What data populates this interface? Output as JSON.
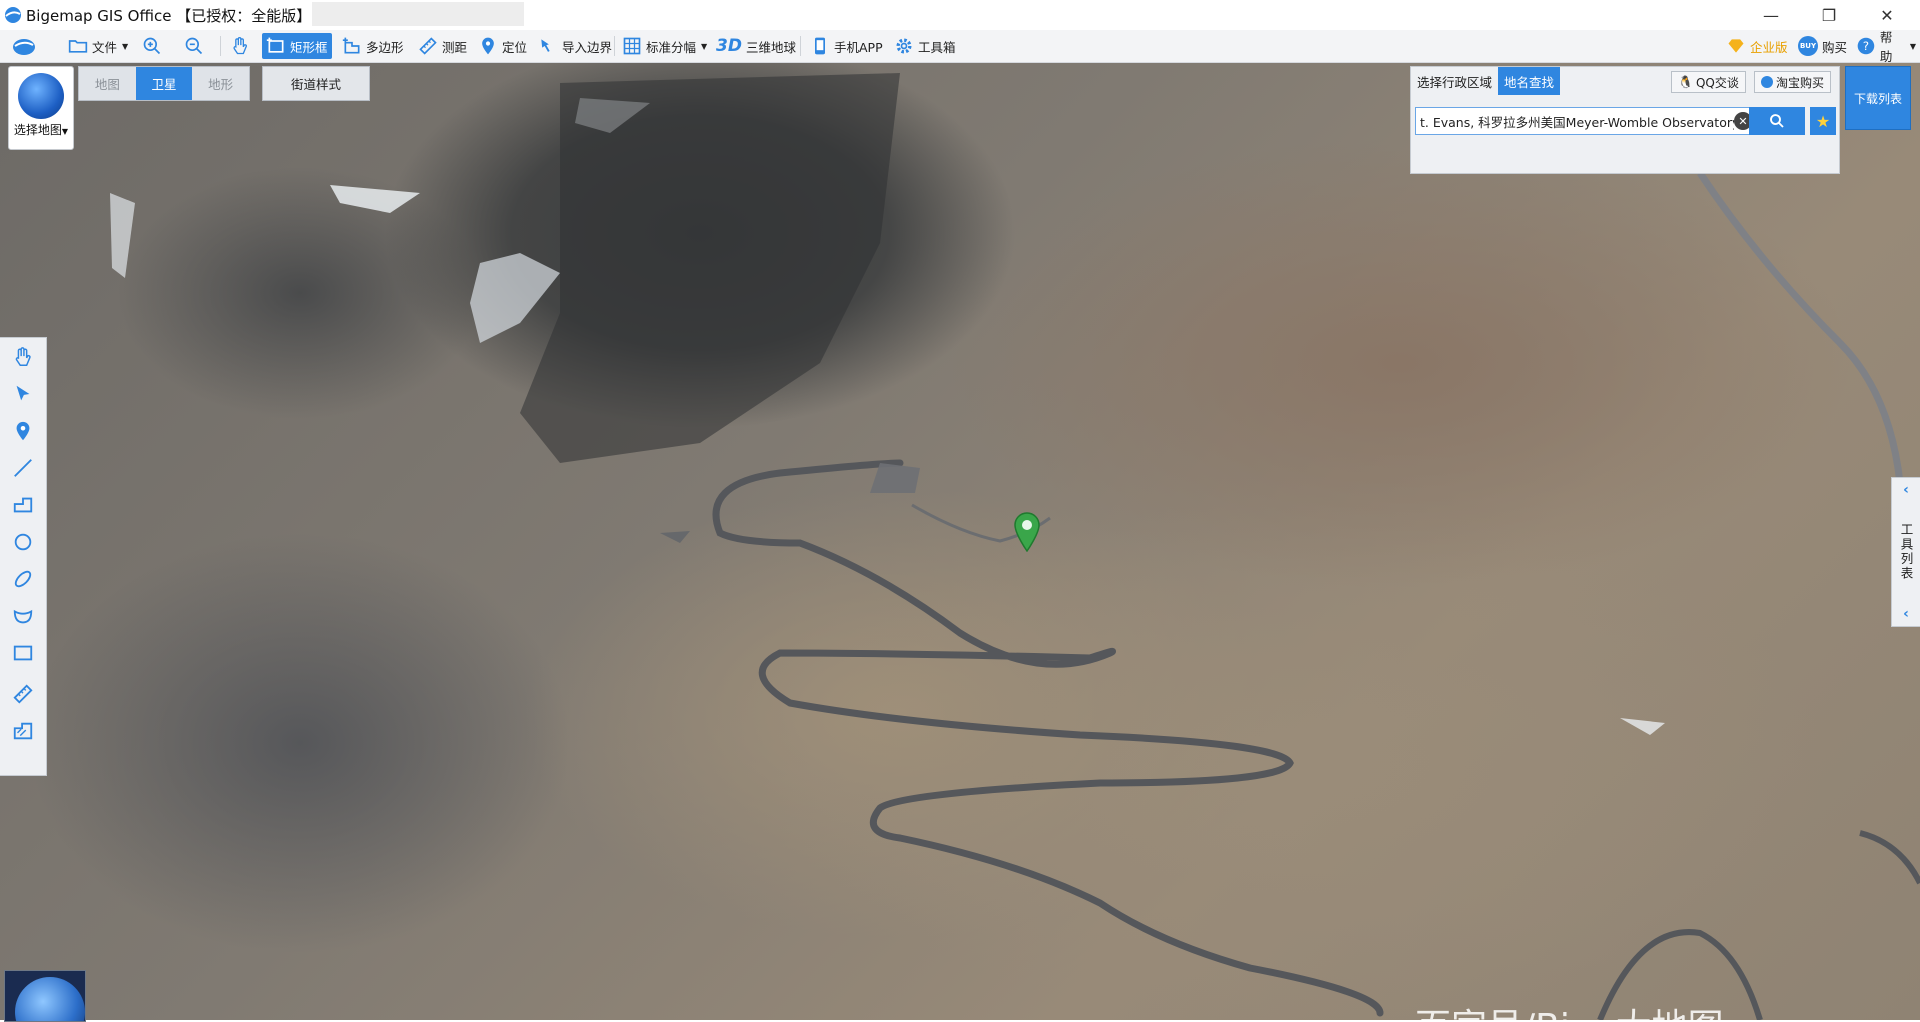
{
  "window": {
    "title": "Bigemap GIS Office 【已授权：全能版】",
    "controls": {
      "minimize": "—",
      "restore": "❐",
      "close": "✕"
    }
  },
  "toolbar": {
    "items": [
      {
        "label": "文件",
        "icon": "folder-icon",
        "dropdown": true
      },
      {
        "label": "",
        "icon": "zoom-in-icon"
      },
      {
        "label": "",
        "icon": "zoom-out-icon"
      },
      {
        "label": "",
        "icon": "pan-hand-icon"
      },
      {
        "label": "矩形框",
        "icon": "rectangle-select-icon",
        "active": true
      },
      {
        "label": "多边形",
        "icon": "polygon-select-icon"
      },
      {
        "label": "测距",
        "icon": "ruler-icon"
      },
      {
        "label": "定位",
        "icon": "location-pin-icon"
      },
      {
        "label": "导入边界",
        "icon": "import-boundary-icon"
      },
      {
        "label": "标准分幅",
        "icon": "grid-icon",
        "dropdown": true
      },
      {
        "label": "3D",
        "icon": "3d-text-icon"
      },
      {
        "label": "三维地球",
        "icon": ""
      },
      {
        "label": "手机APP",
        "icon": "mobile-icon"
      },
      {
        "label": "工具箱",
        "icon": "gear-icon"
      }
    ],
    "right": {
      "enterprise": "企业版",
      "buy": "购买",
      "buy_badge": "BUY",
      "help": "帮助"
    }
  },
  "map": {
    "map_types": [
      {
        "label": "地图",
        "selected": false
      },
      {
        "label": "卫星",
        "selected": true
      },
      {
        "label": "地形",
        "selected": false
      }
    ],
    "street_style": "街道样式",
    "select_map": "选择地图"
  },
  "search_panel": {
    "tabs": [
      {
        "label": "选择行政区域",
        "selected": false
      },
      {
        "label": "地名查找",
        "selected": true
      }
    ],
    "qq_link": "QQ交谈",
    "taobao_link": "淘宝购买",
    "query": "t. Evans, 科罗拉多州美国Meyer-Womble Observatory",
    "clear_symbol": "✕",
    "fav_symbol": "★"
  },
  "download_list": "下载列表",
  "tool_list": {
    "label": "工具列表",
    "chevron": "‹"
  },
  "watermark": "百家号/Bi... 大地图"
}
